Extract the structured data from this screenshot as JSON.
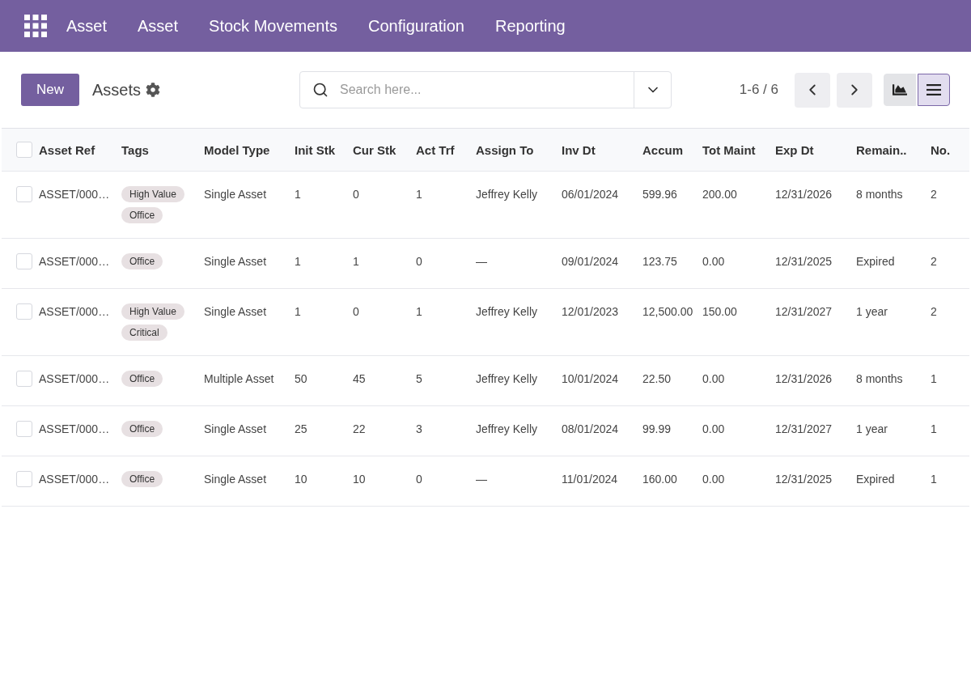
{
  "navbar": {
    "app_name": "Asset",
    "menu": [
      "Asset",
      "Stock Movements",
      "Configuration",
      "Reporting"
    ]
  },
  "control_panel": {
    "new_button": "New",
    "title": "Assets",
    "search": {
      "placeholder": "Search here..."
    },
    "pager": "1-6 / 6",
    "views": [
      {
        "kind": "graph",
        "selected": false
      },
      {
        "kind": "list",
        "selected": true
      }
    ]
  },
  "table": {
    "select_all": {
      "checked": false
    },
    "columns": [
      "Asset Ref",
      "Tags",
      "Model Type",
      "Init Stk",
      "Cur Stk",
      "Act Trf",
      "Assign To",
      "Inv Dt",
      "Accum",
      "Tot Maint",
      "Exp Dt",
      "Remain..",
      "No."
    ],
    "rows": [
      {
        "checked": false,
        "cells": [
          {
            "kind": "text",
            "text": "ASSET/000…"
          },
          {
            "kind": "tags",
            "tags": [
              "High Value",
              "Office"
            ]
          },
          {
            "kind": "text",
            "text": "Single Asset"
          },
          {
            "kind": "text",
            "text": "1"
          },
          {
            "kind": "text",
            "text": "0"
          },
          {
            "kind": "text",
            "text": "1"
          },
          {
            "kind": "text",
            "text": "Jeffrey Kelly"
          },
          {
            "kind": "text",
            "text": "06/01/2024"
          },
          {
            "kind": "text",
            "text": "599.96"
          },
          {
            "kind": "text",
            "text": "200.00"
          },
          {
            "kind": "text",
            "text": "12/31/2026"
          },
          {
            "kind": "text",
            "text": "8 months"
          },
          {
            "kind": "text",
            "text": "2"
          }
        ]
      },
      {
        "checked": false,
        "cells": [
          {
            "kind": "text",
            "text": "ASSET/000…"
          },
          {
            "kind": "tags",
            "tags": [
              "Office"
            ]
          },
          {
            "kind": "text",
            "text": "Single Asset"
          },
          {
            "kind": "text",
            "text": "1"
          },
          {
            "kind": "text",
            "text": "1"
          },
          {
            "kind": "text",
            "text": "0"
          },
          {
            "kind": "text",
            "text": "—"
          },
          {
            "kind": "text",
            "text": "09/01/2024"
          },
          {
            "kind": "text",
            "text": "123.75"
          },
          {
            "kind": "text",
            "text": "0.00"
          },
          {
            "kind": "text",
            "text": "12/31/2025"
          },
          {
            "kind": "text",
            "text": "Expired"
          },
          {
            "kind": "text",
            "text": "2"
          }
        ]
      },
      {
        "checked": false,
        "cells": [
          {
            "kind": "text",
            "text": "ASSET/000…"
          },
          {
            "kind": "tags",
            "tags": [
              "High Value",
              "Critical"
            ]
          },
          {
            "kind": "text",
            "text": "Single Asset"
          },
          {
            "kind": "text",
            "text": "1"
          },
          {
            "kind": "text",
            "text": "0"
          },
          {
            "kind": "text",
            "text": "1"
          },
          {
            "kind": "text",
            "text": "Jeffrey Kelly"
          },
          {
            "kind": "text",
            "text": "12/01/2023"
          },
          {
            "kind": "text",
            "text": "12,500.00"
          },
          {
            "kind": "text",
            "text": "150.00"
          },
          {
            "kind": "text",
            "text": "12/31/2027"
          },
          {
            "kind": "text",
            "text": "1 year"
          },
          {
            "kind": "text",
            "text": "2"
          }
        ]
      },
      {
        "checked": false,
        "cells": [
          {
            "kind": "text",
            "text": "ASSET/000…"
          },
          {
            "kind": "tags",
            "tags": [
              "Office"
            ]
          },
          {
            "kind": "text",
            "text": "Multiple Asset"
          },
          {
            "kind": "text",
            "text": "50"
          },
          {
            "kind": "text",
            "text": "45"
          },
          {
            "kind": "text",
            "text": "5"
          },
          {
            "kind": "text",
            "text": "Jeffrey Kelly"
          },
          {
            "kind": "text",
            "text": "10/01/2024"
          },
          {
            "kind": "text",
            "text": "22.50"
          },
          {
            "kind": "text",
            "text": "0.00"
          },
          {
            "kind": "text",
            "text": "12/31/2026"
          },
          {
            "kind": "text",
            "text": "8 months"
          },
          {
            "kind": "text",
            "text": "1"
          }
        ]
      },
      {
        "checked": false,
        "cells": [
          {
            "kind": "text",
            "text": "ASSET/000…"
          },
          {
            "kind": "tags",
            "tags": [
              "Office"
            ]
          },
          {
            "kind": "text",
            "text": "Single Asset"
          },
          {
            "kind": "text",
            "text": "25"
          },
          {
            "kind": "text",
            "text": "22"
          },
          {
            "kind": "text",
            "text": "3"
          },
          {
            "kind": "text",
            "text": "Jeffrey Kelly"
          },
          {
            "kind": "text",
            "text": "08/01/2024"
          },
          {
            "kind": "text",
            "text": "99.99"
          },
          {
            "kind": "text",
            "text": "0.00"
          },
          {
            "kind": "text",
            "text": "12/31/2027"
          },
          {
            "kind": "text",
            "text": "1 year"
          },
          {
            "kind": "text",
            "text": "1"
          }
        ]
      },
      {
        "checked": false,
        "cells": [
          {
            "kind": "text",
            "text": "ASSET/000…"
          },
          {
            "kind": "tags",
            "tags": [
              "Office"
            ]
          },
          {
            "kind": "text",
            "text": "Single Asset"
          },
          {
            "kind": "text",
            "text": "10"
          },
          {
            "kind": "text",
            "text": "10"
          },
          {
            "kind": "text",
            "text": "0"
          },
          {
            "kind": "text",
            "text": "—"
          },
          {
            "kind": "text",
            "text": "11/01/2024"
          },
          {
            "kind": "text",
            "text": "160.00"
          },
          {
            "kind": "text",
            "text": "0.00"
          },
          {
            "kind": "text",
            "text": "12/31/2025"
          },
          {
            "kind": "text",
            "text": "Expired"
          },
          {
            "kind": "text",
            "text": "1"
          }
        ]
      }
    ]
  }
}
